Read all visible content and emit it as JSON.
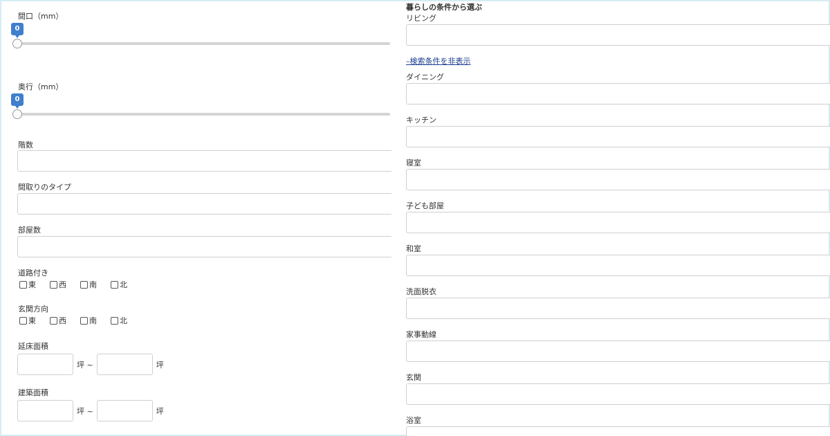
{
  "left": {
    "width_slider": {
      "label": "間口（mm）",
      "value": "0"
    },
    "depth_slider": {
      "label": "奥行（mm）",
      "value": "0"
    },
    "floors": {
      "label": "階数"
    },
    "layout_type": {
      "label": "間取りのタイプ"
    },
    "rooms": {
      "label": "部屋数"
    },
    "road_access": {
      "label": "道路付き",
      "options": [
        "東",
        "西",
        "南",
        "北"
      ]
    },
    "entrance_direction": {
      "label": "玄関方向",
      "options": [
        "東",
        "西",
        "南",
        "北"
      ]
    },
    "total_floor_area": {
      "label": "延床面積",
      "unit_from": "坪 ~",
      "unit_to": "坪"
    },
    "building_area": {
      "label": "建築面積",
      "unit_from": "坪 ~",
      "unit_to": "坪"
    }
  },
  "right": {
    "heading": "暮らしの条件から選ぶ",
    "toggle_link": "–検索条件を非表示",
    "fields": [
      {
        "label": "リビング"
      },
      {
        "label": "ダイニング"
      },
      {
        "label": "キッチン"
      },
      {
        "label": "寝室"
      },
      {
        "label": "子ども部屋"
      },
      {
        "label": "和室"
      },
      {
        "label": "洗面脱衣"
      },
      {
        "label": "家事動線"
      },
      {
        "label": "玄関"
      },
      {
        "label": "浴室"
      }
    ]
  },
  "colors": {
    "accent": "#3f7fcc",
    "link": "#1a3d8f",
    "frame": "#d6ecf5"
  }
}
